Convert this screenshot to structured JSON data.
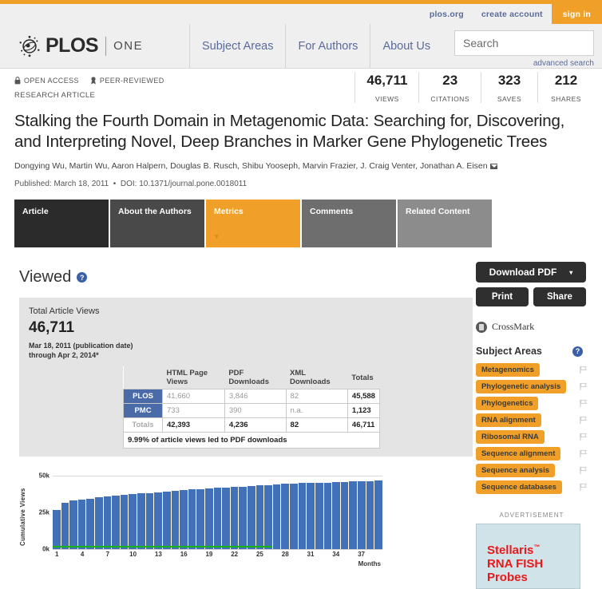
{
  "utility_nav": {
    "links": [
      {
        "label": "plos.org",
        "name": "plos-org-link"
      },
      {
        "label": "create account",
        "name": "create-account-link"
      },
      {
        "label": "sign in",
        "name": "sign-in-button"
      }
    ]
  },
  "masthead": {
    "logo_primary": "PLOS",
    "logo_secondary": "ONE",
    "nav": [
      {
        "label": "Subject Areas"
      },
      {
        "label": "For Authors"
      },
      {
        "label": "About Us"
      }
    ],
    "search": {
      "placeholder": "Search",
      "value": "",
      "advanced_label": "advanced search"
    }
  },
  "article": {
    "badges": [
      {
        "label": "OPEN ACCESS",
        "icon": "lock-icon"
      },
      {
        "label": "PEER-REVIEWED",
        "icon": "peer-review-icon"
      }
    ],
    "kicker": "RESEARCH ARTICLE",
    "title": "Stalking the Fourth Domain in Metagenomic Data: Searching for, Discovering, and Interpreting Novel, Deep Branches in Marker Gene Phylogenetic Trees",
    "authors": "Dongying Wu, Martin Wu, Aaron Halpern, Douglas B. Rusch, Shibu Yooseph, Marvin Frazier, J. Craig Venter, Jonathan A. Eisen",
    "published": "Published: March 18, 2011",
    "doi": "DOI: 10.1371/journal.pone.0018011",
    "metrics": [
      {
        "value": "46,711",
        "label": "VIEWS"
      },
      {
        "value": "23",
        "label": "CITATIONS"
      },
      {
        "value": "323",
        "label": "SAVES"
      },
      {
        "value": "212",
        "label": "SHARES"
      }
    ]
  },
  "tabs": [
    {
      "label": "Article",
      "color": "#2b2b2b",
      "active": false
    },
    {
      "label": "About the Authors",
      "color": "#494949",
      "active": false
    },
    {
      "label": "Metrics",
      "color": "#f0a028",
      "active": true
    },
    {
      "label": "Comments",
      "color": "#6e6e6e",
      "active": false
    },
    {
      "label": "Related Content",
      "color": "#8c8c8c",
      "active": false
    }
  ],
  "viewed_section": {
    "heading": "Viewed",
    "help_glyph": "?",
    "total_label": "Total Article Views",
    "total_value": "46,711",
    "date_range_line1": "Mar 18, 2011 (publication date)",
    "date_range_line2": "through Apr 2, 2014*",
    "table": {
      "columns": [
        "",
        "HTML Page Views",
        "PDF Downloads",
        "XML Downloads",
        "Totals"
      ],
      "rows": [
        {
          "label": "PLOS",
          "html": "41,660",
          "pdf": "3,846",
          "xml": "82",
          "totals": "45,588"
        },
        {
          "label": "PMC",
          "html": "733",
          "pdf": "390",
          "xml": "n.a.",
          "totals": "1,123"
        },
        {
          "label": "Totals",
          "html": "42,393",
          "pdf": "4,236",
          "xml": "82",
          "totals": "46,711"
        }
      ],
      "footnote": "9.99% of article views led to PDF downloads"
    }
  },
  "chart_data": {
    "type": "bar",
    "title": "",
    "xlabel": "Months",
    "ylabel": "Cumulative Views",
    "ylim": [
      0,
      50000
    ],
    "ytick_labels": [
      "0k",
      "25k",
      "50k"
    ],
    "ytick_values": [
      0,
      25000,
      50000
    ],
    "xtick_labels": [
      "1",
      "4",
      "7",
      "10",
      "13",
      "16",
      "19",
      "22",
      "25",
      "28",
      "31",
      "34",
      "37"
    ],
    "xtick_positions": [
      1,
      4,
      7,
      10,
      13,
      16,
      19,
      22,
      25,
      28,
      31,
      34,
      37
    ],
    "grid": true,
    "legend_position": "none",
    "categories": [
      1,
      2,
      3,
      4,
      5,
      6,
      7,
      8,
      9,
      10,
      11,
      12,
      13,
      14,
      15,
      16,
      17,
      18,
      19,
      20,
      21,
      22,
      23,
      24,
      25,
      26,
      27,
      28,
      29,
      30,
      31,
      32,
      33,
      34,
      35,
      36,
      37,
      38,
      39
    ],
    "series": [
      {
        "name": "PLOS cumulative views",
        "color": "#4371b8",
        "values": [
          26800,
          31800,
          33200,
          33700,
          34500,
          35300,
          35900,
          36400,
          36700,
          37400,
          37800,
          38200,
          38600,
          39100,
          39500,
          40100,
          40500,
          40800,
          41200,
          41600,
          42000,
          42400,
          42600,
          42900,
          43300,
          43700,
          44100,
          44600,
          44800,
          45000,
          45100,
          45200,
          45300,
          45500,
          45900,
          46000,
          46200,
          46400,
          46500
        ]
      },
      {
        "name": "PMC cumulative views",
        "color": "#17b317",
        "values": [
          300,
          360,
          420,
          470,
          520,
          570,
          620,
          660,
          700,
          740,
          780,
          830,
          880,
          930,
          980,
          1020,
          1060,
          1090,
          1120,
          1150,
          1180,
          1200,
          1230,
          1260,
          1290,
          1320
        ]
      }
    ]
  },
  "sidebar": {
    "download_label": "Download PDF",
    "download_caret": "▼",
    "print_label": "Print",
    "share_label": "Share",
    "crossmark_label": "CrossMark",
    "subject_areas_heading": "Subject Areas",
    "subject_help_glyph": "?",
    "subject_areas": [
      {
        "label": "Metagenomics"
      },
      {
        "label": "Phylogenetic analysis"
      },
      {
        "label": "Phylogenetics"
      },
      {
        "label": "RNA alignment"
      },
      {
        "label": "Ribosomal RNA"
      },
      {
        "label": "Sequence alignment"
      },
      {
        "label": "Sequence analysis"
      },
      {
        "label": "Sequence databases"
      }
    ],
    "ad_label": "ADVERTISEMENT",
    "ad_line1": "Stellaris",
    "ad_tm": "™",
    "ad_line2": "RNA FISH",
    "ad_line3": "Probes"
  },
  "colors": {
    "accent_orange": "#f0a028",
    "link_blue": "#5a6b9b",
    "bar_blue": "#4371b8",
    "line_green": "#17b317",
    "dark_button": "#2f2f2f"
  }
}
